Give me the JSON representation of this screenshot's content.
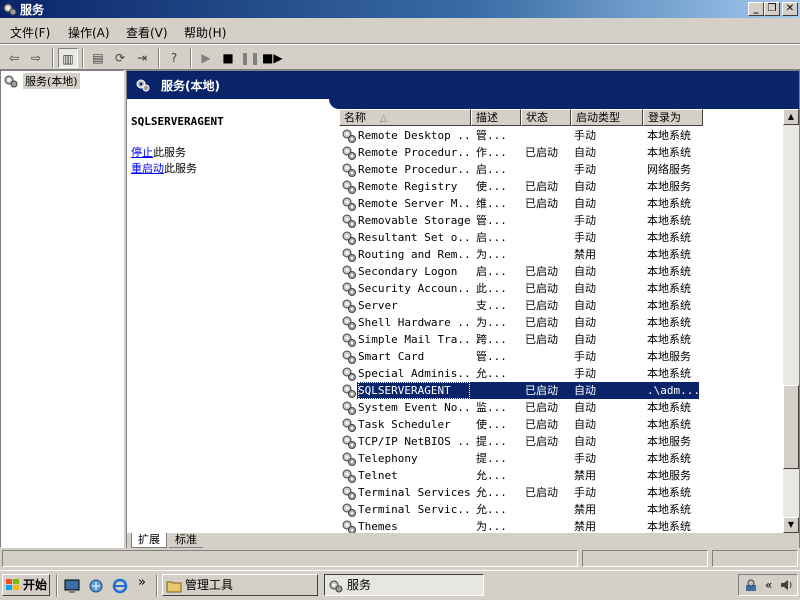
{
  "window": {
    "title": "服务"
  },
  "menu": [
    {
      "label": "文件(F)"
    },
    {
      "label": "操作(A)"
    },
    {
      "label": "查看(V)"
    },
    {
      "label": "帮助(H)"
    }
  ],
  "tree": {
    "root_label": "服务(本地)"
  },
  "pane": {
    "title": "服务(本地)"
  },
  "desc": {
    "service_name": "SQLSERVERAGENT",
    "stop_link": "停止",
    "stop_suffix": "此服务",
    "restart_link": "重启动",
    "restart_suffix": "此服务"
  },
  "columns": [
    {
      "label": "名称"
    },
    {
      "label": "描述"
    },
    {
      "label": "状态"
    },
    {
      "label": "启动类型"
    },
    {
      "label": "登录为"
    }
  ],
  "services": [
    {
      "name": "Remote Desktop ...",
      "desc": "管...",
      "status": "",
      "startup": "手动",
      "logon": "本地系统"
    },
    {
      "name": "Remote Procedur...",
      "desc": "作...",
      "status": "已启动",
      "startup": "自动",
      "logon": "本地系统"
    },
    {
      "name": "Remote Procedur...",
      "desc": "启...",
      "status": "",
      "startup": "手动",
      "logon": "网络服务"
    },
    {
      "name": "Remote Registry",
      "desc": "使...",
      "status": "已启动",
      "startup": "自动",
      "logon": "本地服务"
    },
    {
      "name": "Remote Server M...",
      "desc": "维...",
      "status": "已启动",
      "startup": "自动",
      "logon": "本地系统"
    },
    {
      "name": "Removable Storage",
      "desc": "管...",
      "status": "",
      "startup": "手动",
      "logon": "本地系统"
    },
    {
      "name": "Resultant Set o...",
      "desc": "启...",
      "status": "",
      "startup": "手动",
      "logon": "本地系统"
    },
    {
      "name": "Routing and Rem...",
      "desc": "为...",
      "status": "",
      "startup": "禁用",
      "logon": "本地系统"
    },
    {
      "name": "Secondary Logon",
      "desc": "启...",
      "status": "已启动",
      "startup": "自动",
      "logon": "本地系统"
    },
    {
      "name": "Security Accoun...",
      "desc": "此...",
      "status": "已启动",
      "startup": "自动",
      "logon": "本地系统"
    },
    {
      "name": "Server",
      "desc": "支...",
      "status": "已启动",
      "startup": "自动",
      "logon": "本地系统"
    },
    {
      "name": "Shell Hardware ...",
      "desc": "为...",
      "status": "已启动",
      "startup": "自动",
      "logon": "本地系统"
    },
    {
      "name": "Simple Mail Tra...",
      "desc": "跨...",
      "status": "已启动",
      "startup": "自动",
      "logon": "本地系统"
    },
    {
      "name": "Smart Card",
      "desc": "管...",
      "status": "",
      "startup": "手动",
      "logon": "本地服务"
    },
    {
      "name": "Special Adminis...",
      "desc": "允...",
      "status": "",
      "startup": "手动",
      "logon": "本地系统"
    },
    {
      "name": "SQLSERVERAGENT",
      "desc": "",
      "status": "已启动",
      "startup": "自动",
      "logon": ".\\adm..."
    },
    {
      "name": "System Event No...",
      "desc": "监...",
      "status": "已启动",
      "startup": "自动",
      "logon": "本地系统"
    },
    {
      "name": "Task Scheduler",
      "desc": "使...",
      "status": "已启动",
      "startup": "自动",
      "logon": "本地系统"
    },
    {
      "name": "TCP/IP NetBIOS ...",
      "desc": "提...",
      "status": "已启动",
      "startup": "自动",
      "logon": "本地服务"
    },
    {
      "name": "Telephony",
      "desc": "提...",
      "status": "",
      "startup": "手动",
      "logon": "本地系统"
    },
    {
      "name": "Telnet",
      "desc": "允...",
      "status": "",
      "startup": "禁用",
      "logon": "本地服务"
    },
    {
      "name": "Terminal Services",
      "desc": "允...",
      "status": "已启动",
      "startup": "手动",
      "logon": "本地系统"
    },
    {
      "name": "Terminal Servic...",
      "desc": "允...",
      "status": "",
      "startup": "禁用",
      "logon": "本地系统"
    },
    {
      "name": "Themes",
      "desc": "为...",
      "status": "",
      "startup": "禁用",
      "logon": "本地系统"
    }
  ],
  "selected_index": 15,
  "tabs": [
    {
      "label": "扩展"
    },
    {
      "label": "标准"
    }
  ],
  "taskbar": {
    "start_label": "开始",
    "more_label": "»",
    "tasks": [
      {
        "label": "管理工具"
      },
      {
        "label": "服务"
      }
    ],
    "tray_more": "«"
  },
  "colors": {
    "title_bar": "#0a246a",
    "selection": "#0a246a",
    "face": "#d4d0c8",
    "link": "#0000ff"
  }
}
